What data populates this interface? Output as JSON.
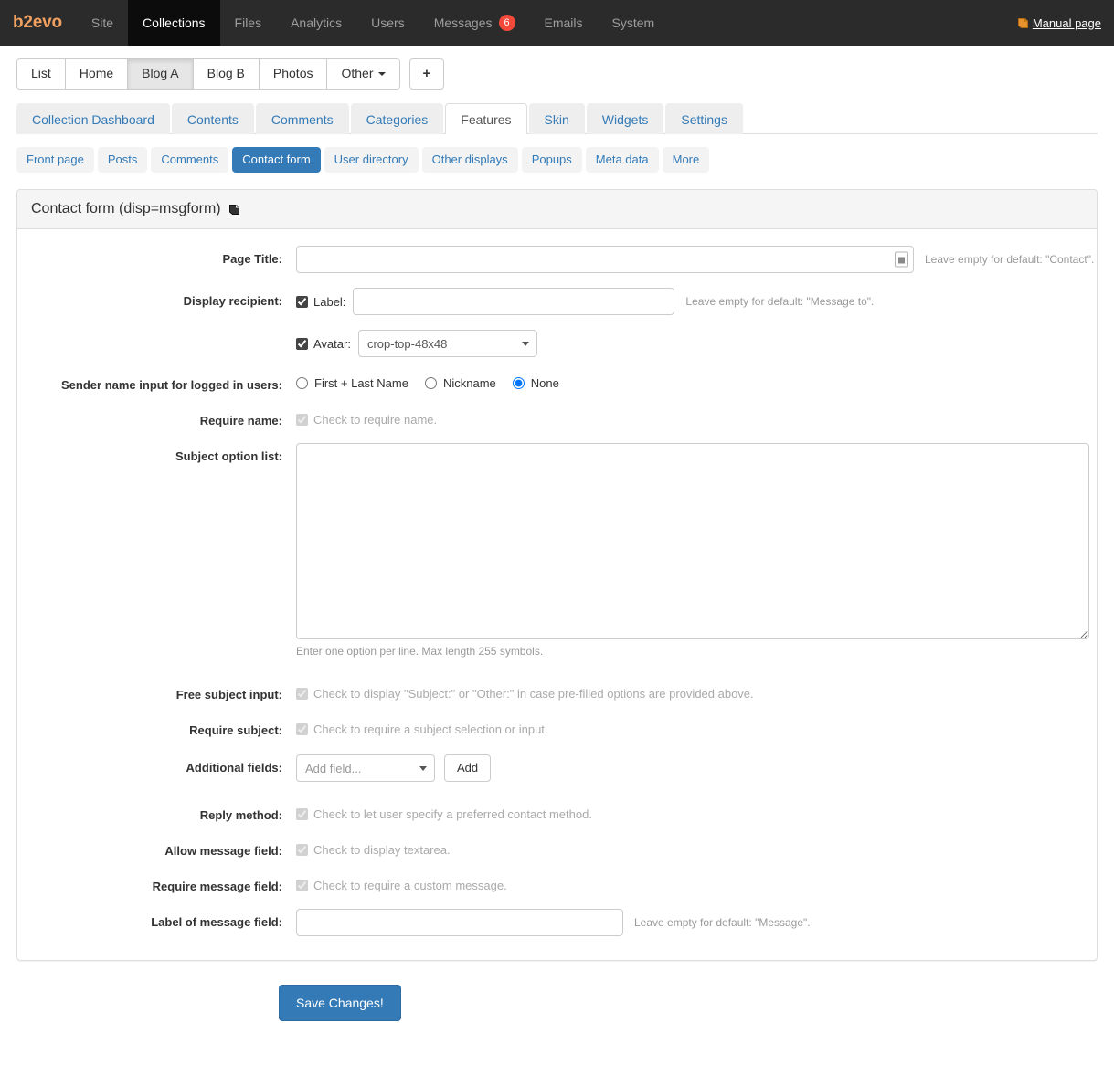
{
  "navbar": {
    "brand": "b2evo",
    "items": [
      {
        "label": "Site",
        "active": false
      },
      {
        "label": "Collections",
        "active": true
      },
      {
        "label": "Files",
        "active": false
      },
      {
        "label": "Analytics",
        "active": false
      },
      {
        "label": "Users",
        "active": false
      },
      {
        "label": "Messages",
        "active": false,
        "badge": "6"
      },
      {
        "label": "Emails",
        "active": false
      },
      {
        "label": "System",
        "active": false
      }
    ],
    "manual_link": "Manual page",
    "bg_color": "#2b2b2b",
    "badge_color": "#f4483b",
    "brand_color": "#e8922f"
  },
  "collection_tabs": {
    "items": [
      {
        "label": "List",
        "active": false
      },
      {
        "label": "Home",
        "active": false
      },
      {
        "label": "Blog A",
        "active": true
      },
      {
        "label": "Blog B",
        "active": false
      },
      {
        "label": "Photos",
        "active": false
      },
      {
        "label": "Other",
        "active": false,
        "caret": true
      }
    ],
    "add_label": "+"
  },
  "main_tabs": {
    "items": [
      {
        "label": "Collection Dashboard",
        "active": false
      },
      {
        "label": "Contents",
        "active": false
      },
      {
        "label": "Comments",
        "active": false
      },
      {
        "label": "Categories",
        "active": false
      },
      {
        "label": "Features",
        "active": true
      },
      {
        "label": "Skin",
        "active": false
      },
      {
        "label": "Widgets",
        "active": false
      },
      {
        "label": "Settings",
        "active": false
      }
    ]
  },
  "sub_tabs": {
    "items": [
      {
        "label": "Front page",
        "active": false
      },
      {
        "label": "Posts",
        "active": false
      },
      {
        "label": "Comments",
        "active": false
      },
      {
        "label": "Contact form",
        "active": true
      },
      {
        "label": "User directory",
        "active": false
      },
      {
        "label": "Other displays",
        "active": false
      },
      {
        "label": "Popups",
        "active": false
      },
      {
        "label": "Meta data",
        "active": false
      },
      {
        "label": "More",
        "active": false
      }
    ],
    "accent_color": "#337ab7"
  },
  "panel": {
    "title": "Contact form (disp=msgform)"
  },
  "form": {
    "page_title": {
      "label": "Page Title:",
      "value": "",
      "hint": "Leave empty for default: \"Contact\"."
    },
    "display_recipient": {
      "label": "Display recipient:",
      "label_checkbox_checked": true,
      "label_text": "Label:",
      "label_value": "",
      "label_hint": "Leave empty for default: \"Message to\".",
      "avatar_checkbox_checked": true,
      "avatar_text": "Avatar:",
      "avatar_value": "crop-top-48x48"
    },
    "sender_name": {
      "label": "Sender name input for logged in users:",
      "options": [
        {
          "label": "First + Last Name",
          "selected": false
        },
        {
          "label": "Nickname",
          "selected": false
        },
        {
          "label": "None",
          "selected": true
        }
      ]
    },
    "require_name": {
      "label": "Require name:",
      "checked": true,
      "text": "Check to require name."
    },
    "subject_option_list": {
      "label": "Subject option list:",
      "value": "",
      "hint": "Enter one option per line. Max length 255 symbols."
    },
    "free_subject_input": {
      "label": "Free subject input:",
      "checked": true,
      "text": "Check to display \"Subject:\" or \"Other:\" in case pre-filled options are provided above."
    },
    "require_subject": {
      "label": "Require subject:",
      "checked": true,
      "text": "Check to require a subject selection or input."
    },
    "additional_fields": {
      "label": "Additional fields:",
      "select_value": "Add field...",
      "add_button": "Add"
    },
    "reply_method": {
      "label": "Reply method:",
      "checked": true,
      "text": "Check to let user specify a preferred contact method."
    },
    "allow_message_field": {
      "label": "Allow message field:",
      "checked": true,
      "text": "Check to display textarea."
    },
    "require_message_field": {
      "label": "Require message field:",
      "checked": true,
      "text": "Check to require a custom message."
    },
    "label_of_message_field": {
      "label": "Label of message field:",
      "value": "",
      "hint": "Leave empty for default: \"Message\"."
    }
  },
  "footer": {
    "save_label": "Save Changes!",
    "save_color": "#337ab7"
  }
}
